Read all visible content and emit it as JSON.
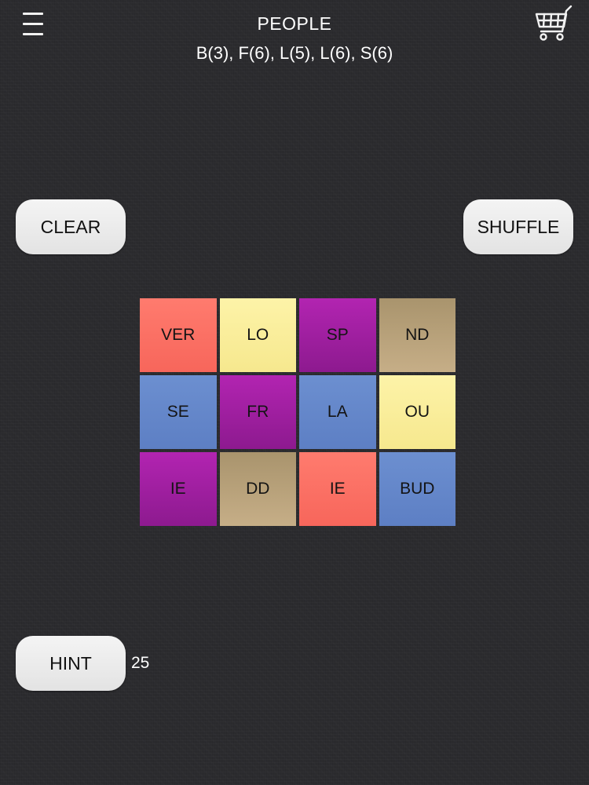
{
  "header": {
    "menu_icon": "hamburger-menu-icon",
    "title": "PEOPLE",
    "subtitle": "B(3), F(6), L(5), L(6), S(6)",
    "cart_icon": "shopping-cart-icon"
  },
  "buttons": {
    "clear": "CLEAR",
    "shuffle": "SHUFFLE",
    "hint": "HINT"
  },
  "hint_count": "25",
  "colors": {
    "red": "#f96f63",
    "yellow": "#f9ec9a",
    "purple": "#9e1f9f",
    "tan": "#b8a27a",
    "blue": "#6687c9"
  },
  "tiles": [
    {
      "text": "VER",
      "color": "red"
    },
    {
      "text": "LO",
      "color": "yellow"
    },
    {
      "text": "SP",
      "color": "purple"
    },
    {
      "text": "ND",
      "color": "tan"
    },
    {
      "text": "SE",
      "color": "blue"
    },
    {
      "text": "FR",
      "color": "purple"
    },
    {
      "text": "LA",
      "color": "blue"
    },
    {
      "text": "OU",
      "color": "yellow"
    },
    {
      "text": "IE",
      "color": "purple"
    },
    {
      "text": "DD",
      "color": "tan"
    },
    {
      "text": "IE",
      "color": "red"
    },
    {
      "text": "BUD",
      "color": "blue"
    }
  ]
}
